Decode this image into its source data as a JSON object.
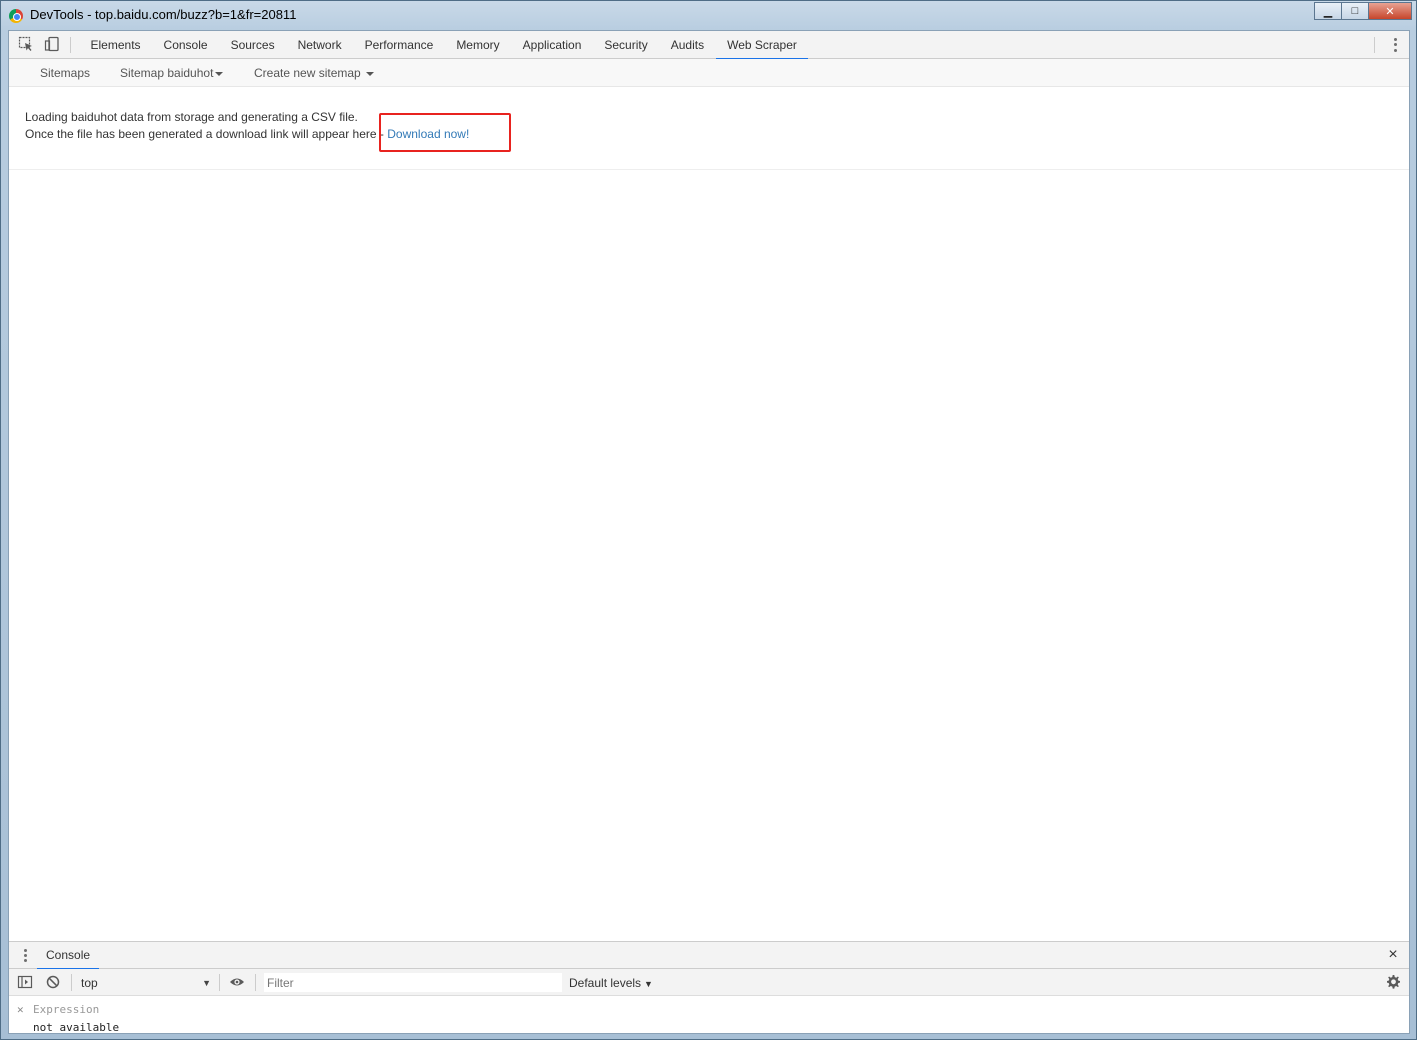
{
  "window": {
    "title": "DevTools - top.baidu.com/buzz?b=1&fr=20811",
    "min_glyph": "▁",
    "max_glyph": "□",
    "close_glyph": "✕"
  },
  "devtools": {
    "tabs": [
      {
        "label": "Elements",
        "active": false
      },
      {
        "label": "Console",
        "active": false
      },
      {
        "label": "Sources",
        "active": false
      },
      {
        "label": "Network",
        "active": false
      },
      {
        "label": "Performance",
        "active": false
      },
      {
        "label": "Memory",
        "active": false
      },
      {
        "label": "Application",
        "active": false
      },
      {
        "label": "Security",
        "active": false
      },
      {
        "label": "Audits",
        "active": false
      },
      {
        "label": "Web Scraper",
        "active": true
      }
    ]
  },
  "scraper": {
    "nav": {
      "sitemaps": "Sitemaps",
      "sitemap_current": "Sitemap baiduhot",
      "create": "Create new sitemap"
    },
    "message_line1": "Loading baiduhot data from storage and generating a CSV file.",
    "message_line2": "Once the file has been generated a download link will appear here ",
    "arrow": "-",
    "download_label": "Download now!",
    "highlight_color": "#e8231f"
  },
  "drawer": {
    "tab_label": "Console",
    "context": "top",
    "filter_placeholder": "Filter",
    "levels_label": "Default levels",
    "watch_expression_placeholder": "Expression",
    "watch_value": "not available"
  },
  "colors": {
    "accent": "#1a73e8",
    "link": "#337ab7"
  }
}
